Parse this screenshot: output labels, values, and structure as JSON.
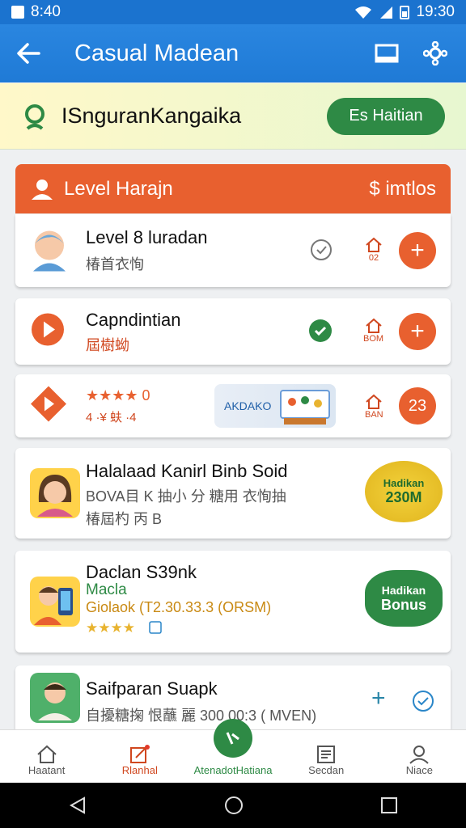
{
  "status_bar": {
    "time": "8:40",
    "right_time": "19:30"
  },
  "app_bar": {
    "title": "Casual Madean"
  },
  "search": {
    "query": "ISnguranKangaika",
    "button_label": "Es Haitian"
  },
  "level_section": {
    "header_label": "Level Harajn",
    "header_count": "$ imtlos"
  },
  "cards": [
    {
      "title": "Level 8 luradan",
      "subtitle": "椿首衣恂",
      "home_label": "02"
    },
    {
      "title": "Capndintian",
      "subtitle": "屆樹蚴",
      "home_label": "BOM"
    },
    {
      "rating_text": "★★★★ 0",
      "rating_sub": "4 ·¥ 蚨 ·4",
      "chip_label": "AKDAKO",
      "badge_value": "23",
      "home_label": "BAN"
    },
    {
      "title": "Halalaad Kanirl Binb Soid",
      "subtitle": "BOVA目 K 抽小 分 糖用 衣恂抽",
      "subtitle2": "椿屆杓 丙  B",
      "bonus_text": "Hadikan",
      "bonus_value": "230M"
    },
    {
      "title": "Daclan S39nk",
      "line2": "Macla",
      "line3": "Giolaok  (T2.30.33.3 (ORSM)",
      "stars": "★★★★",
      "bonus_line1": "Hadikan",
      "bonus_line2": "Bonus"
    },
    {
      "title": "Saifparan Suapk",
      "subtitle": "自擾糖掬 恨蘸 麗 300 00:3 ( MVEN)"
    }
  ],
  "bottom_nav": [
    {
      "label": "Haatant"
    },
    {
      "label": "Rlanhal"
    },
    {
      "label": "AtenadotHatiana"
    },
    {
      "label": "Secdan"
    },
    {
      "label": "Niace"
    }
  ],
  "colors": {
    "primary": "#1f7ad6",
    "accent_orange": "#e8602f",
    "accent_green": "#2e8a45",
    "search_bg": "#fff8c9"
  }
}
